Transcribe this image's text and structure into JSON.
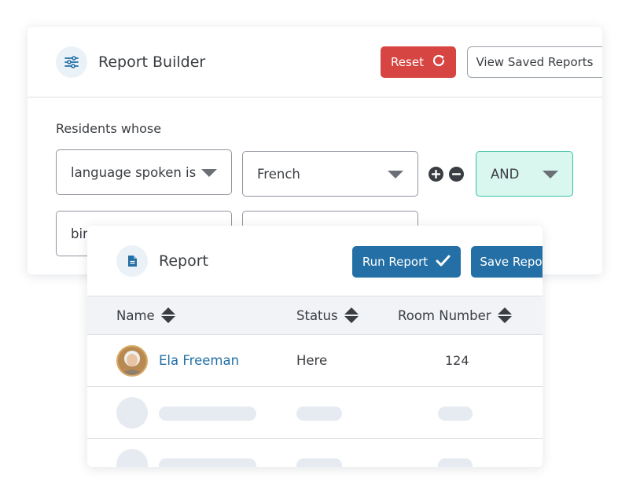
{
  "builder": {
    "title": "Report Builder",
    "reset_label": "Reset",
    "view_saved_label": "View Saved Reports",
    "section_label": "Residents whose",
    "conditions": [
      {
        "field": "language spoken is",
        "value": "French",
        "logic": "AND"
      },
      {
        "field": "bir",
        "value": ""
      }
    ]
  },
  "report": {
    "title": "Report",
    "run_label": "Run Report",
    "save_label": "Save Report",
    "columns": [
      "Name",
      "Status",
      "Room Number"
    ],
    "rows": [
      {
        "name": "Ela Freeman",
        "status": "Here",
        "room": "124"
      }
    ]
  },
  "colors": {
    "primary": "#2470a6",
    "danger": "#d64541",
    "logic_bg": "#d9f6ef",
    "logic_border": "#39c0a6",
    "placeholder": "#e6eaf1"
  },
  "icons": {
    "builder": "sliders-icon",
    "reset": "refresh-icon",
    "view_saved": "eye-icon",
    "report": "document-icon",
    "run": "check-icon",
    "save": "floppy-disk-icon",
    "sort": "sort-icon"
  }
}
